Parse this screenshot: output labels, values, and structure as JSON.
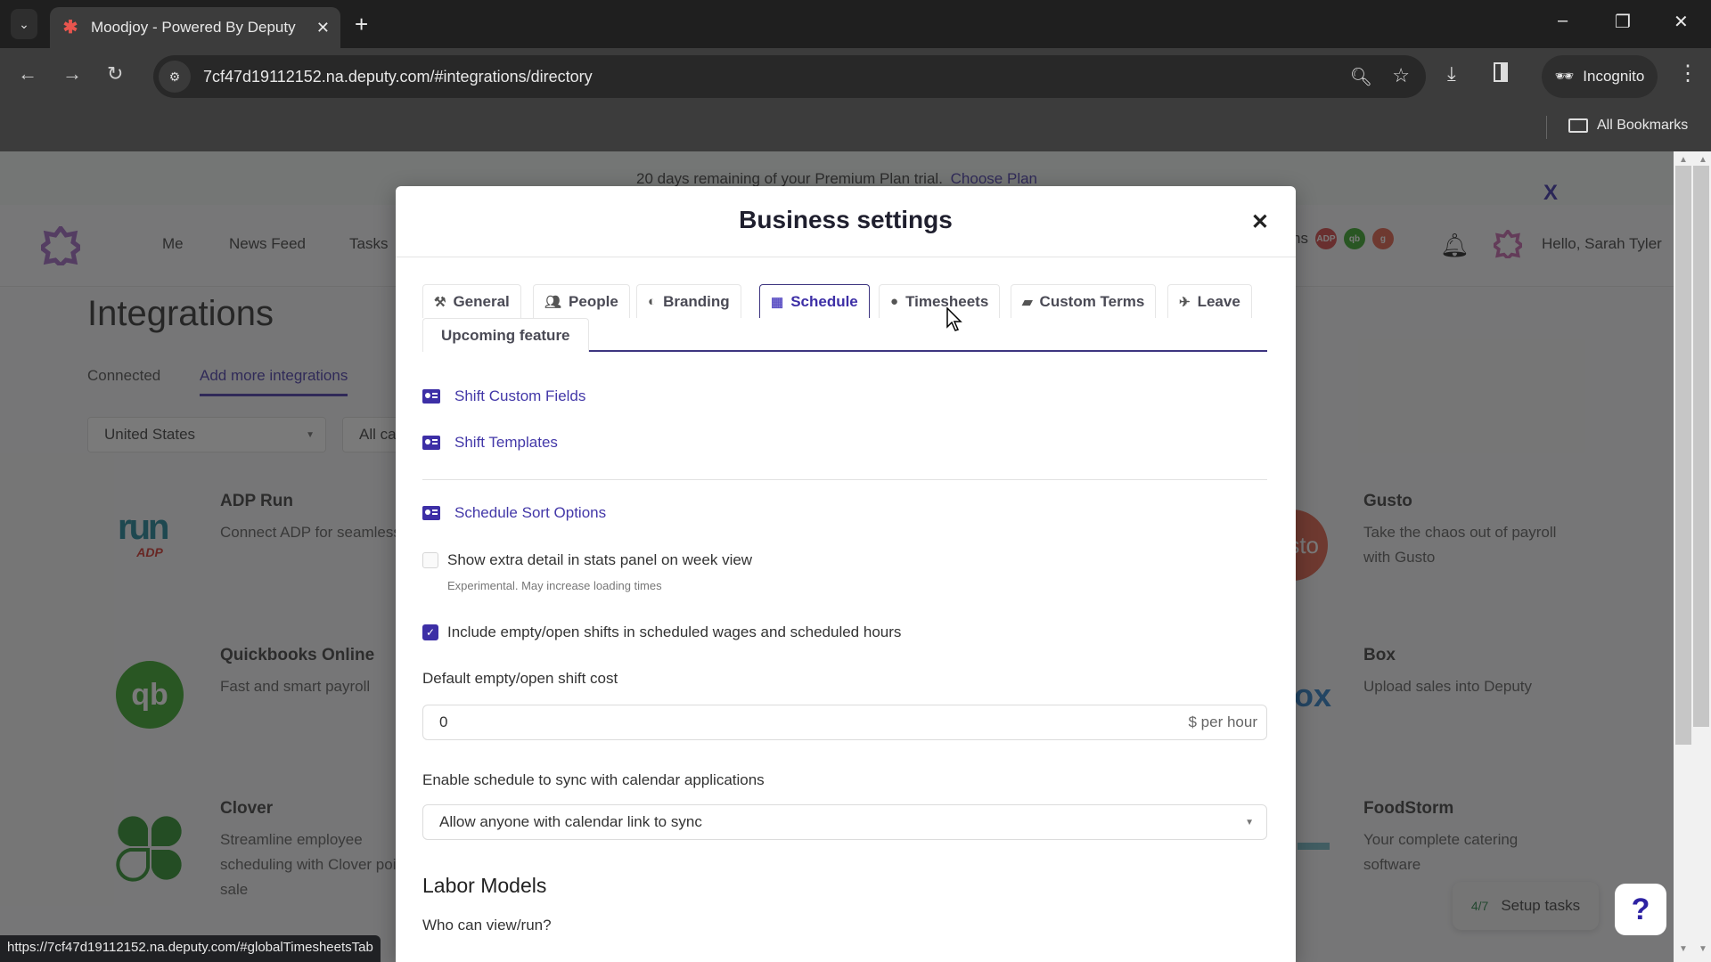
{
  "browser": {
    "tab_title": "Moodjoy - Powered By Deputy",
    "tab_close": "✕",
    "new_tab": "+",
    "url": "7cf47d19112152.na.deputy.com/#integrations/directory",
    "incognito_label": "Incognito",
    "all_bookmarks": "All Bookmarks",
    "status_url": "https://7cf47d19112152.na.deputy.com/#globalTimesheetsTab",
    "window_controls": {
      "minimize": "–",
      "restore": "❐",
      "close": "✕"
    }
  },
  "banner": {
    "text": "20 days remaining of your Premium Plan trial.",
    "link": "Choose Plan",
    "close": "X"
  },
  "topnav": {
    "items": [
      "Me",
      "News Feed",
      "Tasks"
    ],
    "partial_item": "ns",
    "integration_badges": [
      {
        "label": "ADP",
        "color": "#d13b3b"
      },
      {
        "label": "qb",
        "color": "#2ca01c"
      },
      {
        "label": "g",
        "color": "#e0553d"
      }
    ],
    "greeting": "Hello, Sarah Tyler"
  },
  "integrations_page": {
    "title": "Integrations",
    "tabs": [
      {
        "label": "Connected",
        "active": false
      },
      {
        "label": "Add more integrations",
        "active": true
      }
    ],
    "country_filter": "United States",
    "category_filter": "All ca",
    "cards_left": [
      {
        "name": "ADP Run",
        "desc": "Connect ADP for seamless payroll",
        "logo": "run"
      },
      {
        "name": "Quickbooks Online",
        "desc": "Fast and smart payroll",
        "logo": "qb"
      },
      {
        "name": "Clover",
        "desc": "Streamline employee scheduling with Clover point of sale",
        "logo": "clover"
      }
    ],
    "cards_right": [
      {
        "name": "Gusto",
        "desc": "Take the chaos out of payroll with Gusto",
        "logo": "sto"
      },
      {
        "name": "Box",
        "desc": "Upload sales into Deputy",
        "logo": "ox"
      },
      {
        "name": "FoodStorm",
        "desc": "Your complete catering software",
        "logo": "foodstorm"
      }
    ],
    "setup_tasks": {
      "count": "4/7",
      "label": "Setup tasks"
    },
    "help": "?"
  },
  "modal": {
    "title": "Business settings",
    "close": "✕",
    "tabs": [
      {
        "label": "General",
        "icon": "tools-icon",
        "glyph": "⚒",
        "active": false
      },
      {
        "label": "People",
        "icon": "people-icon",
        "glyph": "👥",
        "active": false
      },
      {
        "label": "Branding",
        "icon": "palette-icon",
        "glyph": "◐",
        "active": false
      },
      {
        "label": "Schedule",
        "icon": "calendar-icon",
        "glyph": "▦",
        "active": true
      },
      {
        "label": "Timesheets",
        "icon": "clock-icon",
        "glyph": "●",
        "active": false
      },
      {
        "label": "Custom Terms",
        "icon": "book-icon",
        "glyph": "▰",
        "active": false
      },
      {
        "label": "Leave",
        "icon": "plane-icon",
        "glyph": "✈",
        "active": false
      },
      {
        "label": "Upcoming feature",
        "icon": "",
        "glyph": "",
        "active": false
      }
    ],
    "schedule": {
      "links": [
        "Shift Custom Fields",
        "Shift Templates",
        "Schedule Sort Options"
      ],
      "extra_detail": {
        "label": "Show extra detail in stats panel on week view",
        "hint": "Experimental. May increase loading times",
        "checked": false
      },
      "include_empty": {
        "label": "Include empty/open shifts in scheduled wages and scheduled hours",
        "checked": true
      },
      "default_cost": {
        "label": "Default empty/open shift cost",
        "value": "0",
        "suffix": "$ per hour"
      },
      "calendar_sync": {
        "label": "Enable schedule to sync with calendar applications",
        "selected": "Allow anyone with calendar link to sync"
      },
      "labor_models": {
        "title": "Labor Models",
        "who_label": "Who can view/run?"
      }
    }
  }
}
